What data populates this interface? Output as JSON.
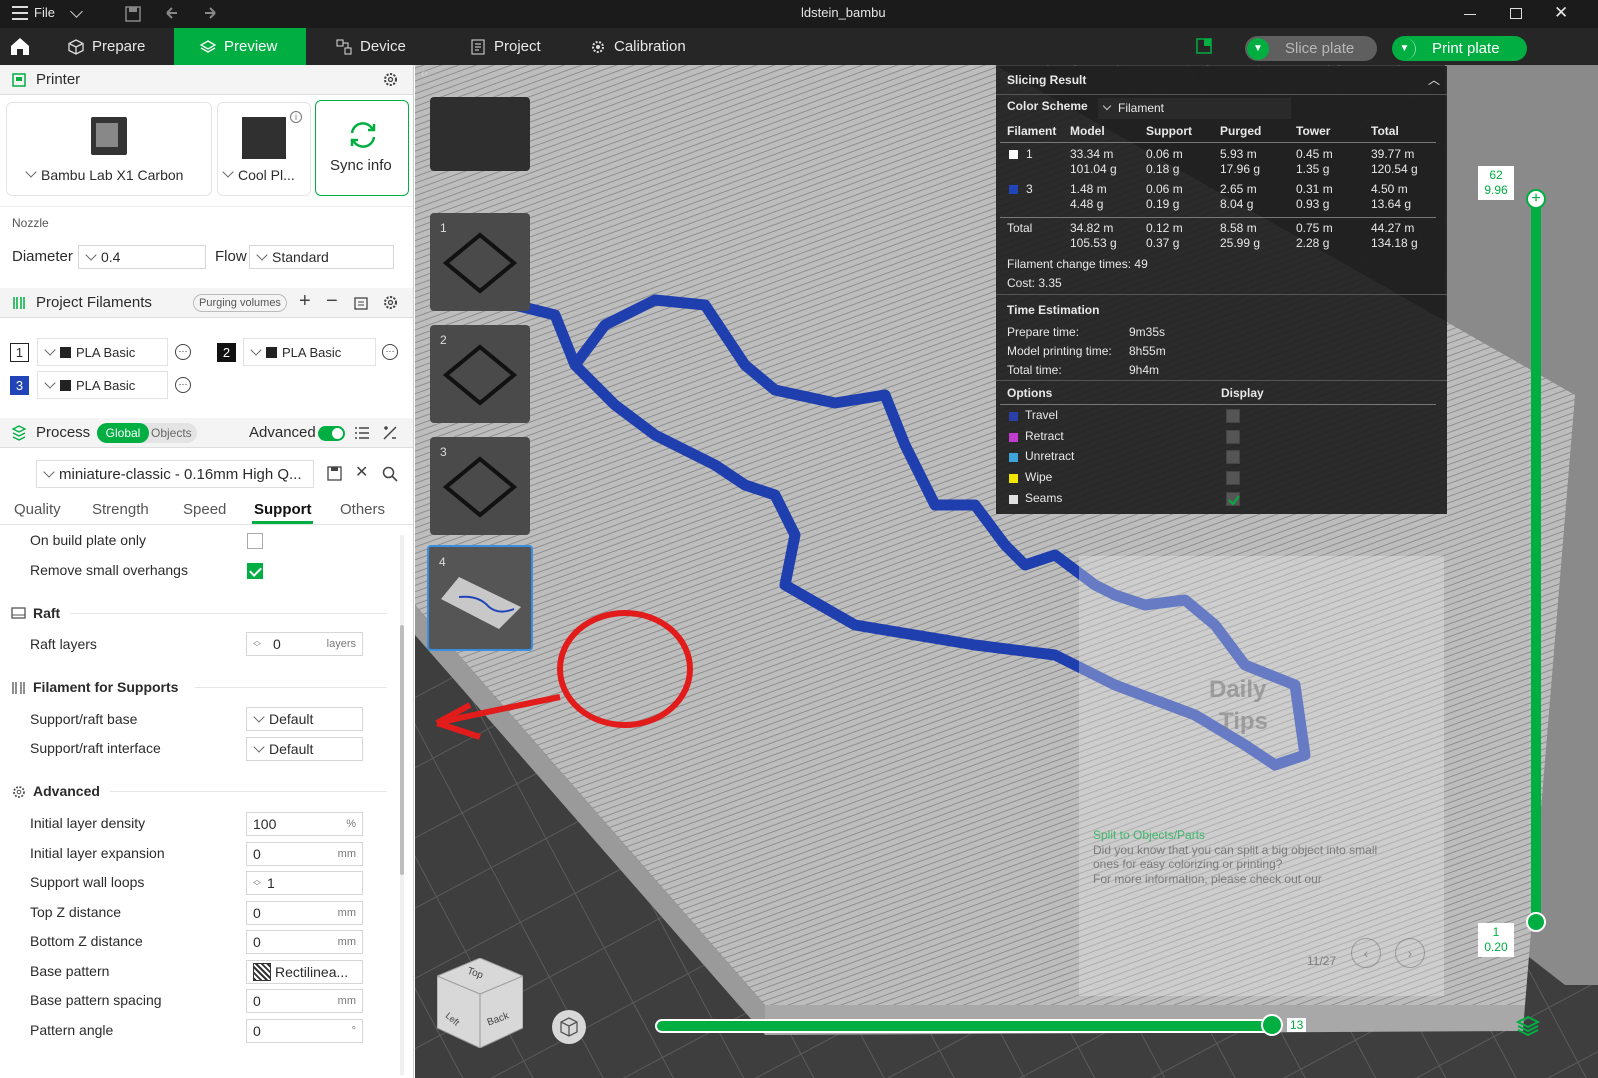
{
  "window": {
    "title": "ldstein_bambu",
    "menu": "File"
  },
  "nav": {
    "tabs": [
      "Prepare",
      "Preview",
      "Device",
      "Project",
      "Calibration"
    ],
    "active": "Preview",
    "slice_label": "Slice plate",
    "print_label": "Print plate",
    "accent": "#00ae42"
  },
  "printer": {
    "header": "Printer",
    "name": "Bambu Lab X1 Carbon",
    "plate": "Cool Pl...",
    "sync": "Sync info",
    "nozzle_label": "Nozzle",
    "diameter_label": "Diameter",
    "diameter": "0.4",
    "flow_label": "Flow",
    "flow": "Standard"
  },
  "filaments": {
    "header": "Project Filaments",
    "purging": "Purging volumes",
    "items": [
      {
        "num": "1",
        "name": "PLA Basic"
      },
      {
        "num": "2",
        "name": "PLA Basic"
      },
      {
        "num": "3",
        "name": "PLA Basic"
      }
    ]
  },
  "process": {
    "header": "Process",
    "global": "Global",
    "objects": "Objects",
    "advanced": "Advanced",
    "preset": "miniature-classic - 0.16mm High Q...",
    "tabs": [
      "Quality",
      "Strength",
      "Speed",
      "Support",
      "Others"
    ],
    "active_tab": "Support"
  },
  "settings": {
    "on_build_plate_only": "On build plate only",
    "remove_small_overhangs": "Remove small overhangs",
    "raft_header": "Raft",
    "raft_layers_label": "Raft layers",
    "raft_layers": "0",
    "raft_layers_unit": "layers",
    "filament_support_header": "Filament for Supports",
    "support_base_label": "Support/raft base",
    "support_base": "Default",
    "support_interface_label": "Support/raft interface",
    "support_interface": "Default",
    "advanced_header": "Advanced",
    "rows": [
      {
        "label": "Initial layer density",
        "value": "100",
        "unit": "%"
      },
      {
        "label": "Initial layer expansion",
        "value": "0",
        "unit": "mm"
      },
      {
        "label": "Support wall loops",
        "value": "1",
        "unit": ""
      },
      {
        "label": "Top Z distance",
        "value": "0",
        "unit": "mm"
      },
      {
        "label": "Bottom Z distance",
        "value": "0",
        "unit": "mm"
      },
      {
        "label": "Base pattern",
        "value": "Rectilinea...",
        "unit": ""
      },
      {
        "label": "Base pattern spacing",
        "value": "0",
        "unit": "mm"
      },
      {
        "label": "Pattern angle",
        "value": "0",
        "unit": "°"
      }
    ]
  },
  "slicing": {
    "title": "Slicing Result",
    "color_scheme_label": "Color Scheme",
    "color_scheme": "Filament",
    "columns": [
      "Filament",
      "Model",
      "Support",
      "Purged",
      "Tower",
      "Total"
    ],
    "rows": [
      {
        "id": "1",
        "color": "#ffffff",
        "model": [
          "33.34 m",
          "101.04 g"
        ],
        "support": [
          "0.06 m",
          "0.18 g"
        ],
        "purged": [
          "5.93 m",
          "17.96 g"
        ],
        "tower": [
          "0.45 m",
          "1.35 g"
        ],
        "total": [
          "39.77 m",
          "120.54 g"
        ]
      },
      {
        "id": "3",
        "color": "#2145b8",
        "model": [
          "1.48 m",
          "4.48 g"
        ],
        "support": [
          "0.06 m",
          "0.19 g"
        ],
        "purged": [
          "2.65 m",
          "8.04 g"
        ],
        "tower": [
          "0.31 m",
          "0.93 g"
        ],
        "total": [
          "4.50 m",
          "13.64 g"
        ]
      }
    ],
    "total": {
      "label": "Total",
      "model": [
        "34.82 m",
        "105.53 g"
      ],
      "support": [
        "0.12 m",
        "0.37 g"
      ],
      "purged": [
        "8.58 m",
        "25.99 g"
      ],
      "tower": [
        "0.75 m",
        "2.28 g"
      ],
      "total": [
        "44.27 m",
        "134.18 g"
      ]
    },
    "change_times": "Filament change times:  49",
    "cost": "Cost:  3.35",
    "time_header": "Time Estimation",
    "prepare_label": "Prepare time:",
    "prepare": "9m35s",
    "model_label": "Model printing time:",
    "model": "8h55m",
    "total_label": "Total time:",
    "total_time": "9h4m",
    "options_header": "Options",
    "display_header": "Display",
    "options": [
      {
        "name": "Travel",
        "color": "#2b3fa8",
        "display": false
      },
      {
        "name": "Retract",
        "color": "#c13ccf",
        "display": false
      },
      {
        "name": "Unretract",
        "color": "#3da5d9",
        "display": false
      },
      {
        "name": "Wipe",
        "color": "#f2e600",
        "display": false
      },
      {
        "name": "Seams",
        "color": "#e0e0e0",
        "display": true
      }
    ]
  },
  "slider": {
    "top_layer": "62",
    "top_height": "9.96",
    "bottom_layer": "1",
    "bottom_height": "0.20",
    "horizontal": "13"
  },
  "plates": [
    "1",
    "2",
    "3",
    "4"
  ],
  "tip": {
    "title": "Split to Objects/Parts",
    "text1": "Did you know that you can split a big object into small",
    "text2": "ones for easy colorizing or printing?",
    "text3": "For more information, please check out our",
    "brand1": "Daily",
    "brand2": "Tips",
    "page": "11/27"
  },
  "cube": {
    "top": "Top",
    "back": "Back",
    "left": "Left"
  }
}
